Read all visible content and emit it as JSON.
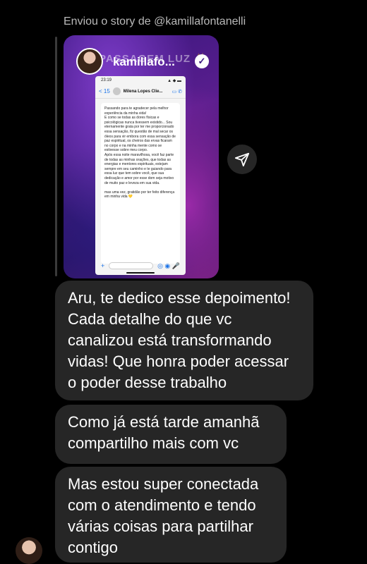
{
  "header": {
    "text": "Enviou o story de @kamillafontanelli"
  },
  "story": {
    "username": "kamillafo...",
    "background_text": "PASSAGEM LUZ ✨",
    "verified_badge": "✓",
    "screenshot": {
      "time": "23:19",
      "status_icons": "▲ ◆ ▬",
      "back_label": "< 15",
      "contact_name": "Milena Lopes Clie...",
      "header_icons": "▭ ✆",
      "message_text": "Passando para te agradecer pela melhor experiência da minha vida!\nE como se todas as dores físicas e psicológicas nunca tivessem existido... Sou eternamente grata por ter me proporcionado essa sensação, fiz questão de mal secar os óleos para vir embora com essa sensação de paz espiritual, os cheiros das ervas ficaram no corpo e na minha mente como se estivesse sobre meu corpo.\nApós essa noite maravilhosa, você faz parte de todas as minhas orações, que todas as energias e mentores espirituais, estejam sempre em seu caminho e te guiando para essa luz que tem sobre você, que sua dedicação e amor por esse dom seja motivo de muito paz e leveza em sua vida.\n\nmas uma vez, gratidão por ter feito diferença em minha vida 💛",
      "footer_plus": "+",
      "footer_icons": "◎ ◉ 🎤"
    }
  },
  "share_icon": "paper-plane-icon",
  "messages": [
    "Aru, te dedico esse depoimento! Cada detalhe do que vc canalizou está transformando vidas! Que honra poder acessar o poder desse trabalho",
    "Como já está tarde amanhã compartilho mais com vc",
    "Mas estou super conectada com o atendimento e tendo várias coisas para partilhar contigo"
  ]
}
